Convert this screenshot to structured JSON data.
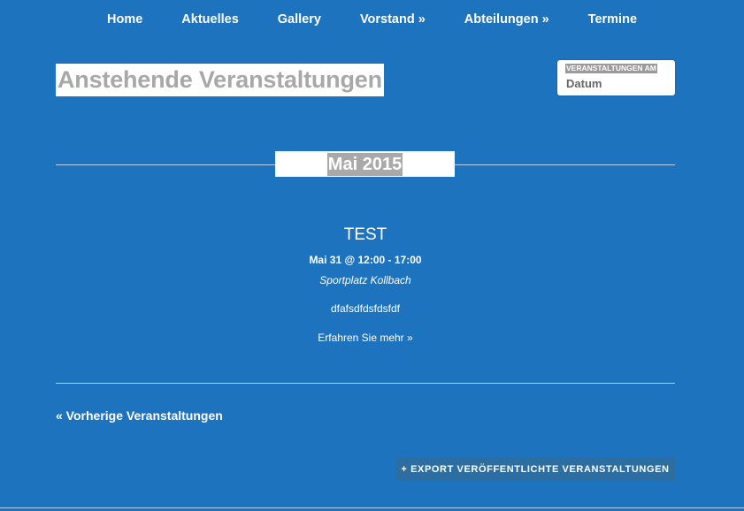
{
  "nav": {
    "items": [
      {
        "label": "Home"
      },
      {
        "label": "Aktuelles"
      },
      {
        "label": "Gallery"
      },
      {
        "label": "Vorstand »"
      },
      {
        "label": "Abteilungen »"
      },
      {
        "label": "Termine"
      }
    ]
  },
  "page": {
    "title": "Anstehende Veranstaltungen"
  },
  "date_filter": {
    "label": "VERANSTALTUNGEN AM",
    "value": "Datum"
  },
  "month_separator": {
    "label": "Mai 2015"
  },
  "event": {
    "title": "TEST",
    "datetime": "Mai 31 @ 12:00 - 17:00",
    "venue": "Sportplatz Kollbach",
    "description": "dfafsdfdsfdsfdf",
    "more_link": "Erfahren Sie mehr »"
  },
  "pagination": {
    "previous_label": "« Vorherige Veranstaltungen"
  },
  "export": {
    "label": "+ EXPORT VERÖFFENTLICHTE VERANSTALTUNGEN"
  },
  "colors": {
    "background": "#1e73be",
    "export_button": "#2c6ea1",
    "title_text": "#a8a8a8"
  }
}
